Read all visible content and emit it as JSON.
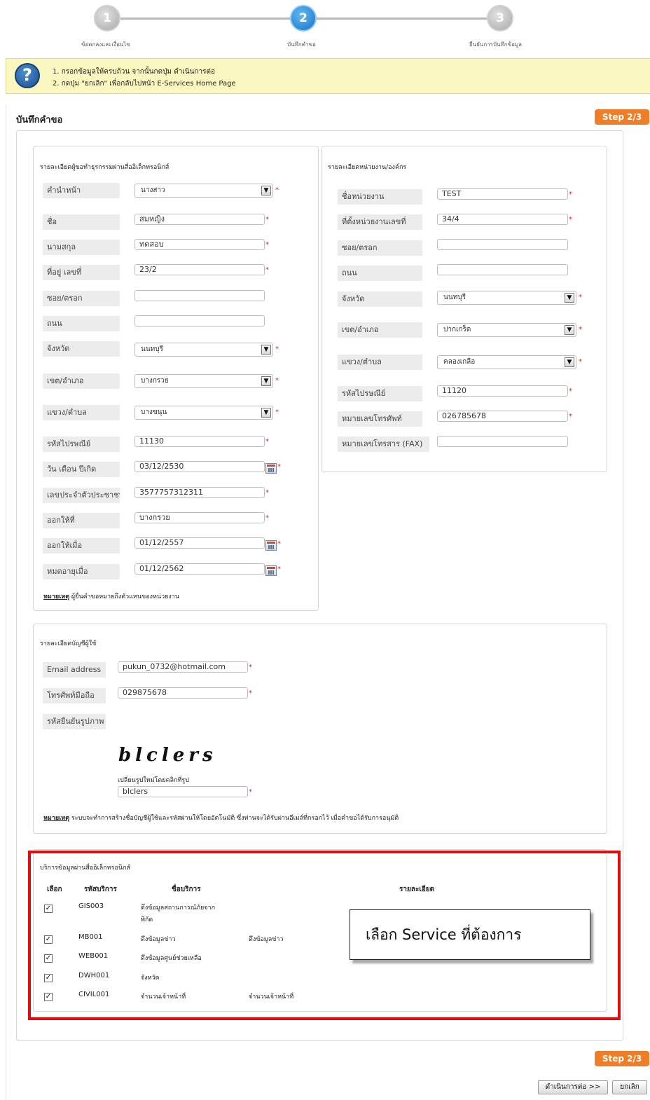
{
  "stepper": {
    "steps": [
      {
        "number": "1",
        "label": "ข้อตกลงและเงื่อนไข"
      },
      {
        "number": "2",
        "label": "บันทึกคำขอ"
      },
      {
        "number": "3",
        "label": "ยืนยันการบันทึกข้อมูล"
      }
    ]
  },
  "info": {
    "lines": [
      "1.  กรอกข้อมูลให้ครบถ้วน จากนั้นกดปุ่ม ดำเนินการต่อ",
      "2.  กดปุ่ม \"ยกเลิก\" เพื่อกลับไปหน้า E-Services Home Page"
    ]
  },
  "page": {
    "title": "บันทึกคำขอ",
    "step_badge": "Step 2/3"
  },
  "applicant": {
    "title": "รายละเอียดผู้ขอทำธุรกรรมผ่านสื่ออิเล็กทรอนิกส์",
    "labels": {
      "prefix": "คำนำหน้า",
      "first_name": "ชื่อ",
      "last_name": "นามสกุล",
      "address_no": "ที่อยู่ เลขที่",
      "soi": "ซอย/ตรอก",
      "road": "ถนน",
      "province": "จังหวัด",
      "district": "เขต/อำเภอ",
      "subdistrict": "แขวง/ตำบล",
      "postcode": "รหัสไปรษณีย์",
      "birthdate": "วัน เดือน ปีเกิด",
      "citizen_id": "เลขประจำตัวประชาชน",
      "issued_at": "ออกให้ที่",
      "issued_on": "ออกให้เมื่อ",
      "expires_on": "หมดอายุเมื่อ"
    },
    "values": {
      "prefix": "นางสาว",
      "first_name": "สมหญิง",
      "last_name": "ทดสอบ",
      "address_no": "23/2",
      "soi": "",
      "road": "",
      "province": "นนทบุรี",
      "district": "บางกรวย",
      "subdistrict": "บางขนุน",
      "postcode": "11130",
      "birthdate": "03/12/2530",
      "citizen_id": "3577757312311",
      "issued_at": "บางกรวย",
      "issued_on": "01/12/2557",
      "expires_on": "01/12/2562"
    },
    "note_label": "หมายเหตุ",
    "note_text": " ผู้ยื่นคำขอหมายถึงตัวแทนของหน่วยงาน"
  },
  "organization": {
    "title": "รายละเอียดหน่วยงาน/องค์กร",
    "labels": {
      "name": "ชื่อหน่วยงาน",
      "address_no": "ที่ตั้งหน่วยงานเลขที่",
      "soi": "ซอย/ตรอก",
      "road": "ถนน",
      "province": "จังหวัด",
      "district": "เขต/อำเภอ",
      "subdistrict": "แขวง/ตำบล",
      "postcode": "รหัสไปรษณีย์",
      "phone": "หมายเลขโทรศัพท์",
      "fax": "หมายเลขโทรสาร (FAX)"
    },
    "values": {
      "name": "TEST",
      "address_no": "34/4",
      "soi": "",
      "road": "",
      "province": "นนทบุรี",
      "district": "ปากเกร็ด",
      "subdistrict": "คลองเกลือ",
      "postcode": "11120",
      "phone": "026785678",
      "fax": ""
    }
  },
  "account": {
    "title": "รายละเอียดบัญชีผู้ใช้",
    "labels": {
      "email": "Email address",
      "mobile": "โทรศัพท์มือถือ",
      "captcha": "รหัสยืนยันรูปภาพ"
    },
    "values": {
      "email": "pukun_0732@hotmail.com",
      "mobile": "029875678",
      "captcha_input": "blclers"
    },
    "captcha_image_text": "blclers",
    "captcha_refresh": "เปลี่ยนรูปใหม่โดยคลิกที่รูป",
    "note_label": "หมายเหตุ",
    "note_text": " ระบบจะทำการสร้างชื่อบัญชีผู้ใช้และรหัสผ่านให้โดยอัตโนมัติ ซึ่งท่านจะได้รับผ่านอีเมล์ที่กรอกไว้ เมื่อคำขอได้รับการอนุมัติ"
  },
  "services": {
    "title": "บริการข้อมูลผ่านสื่ออิเล็กทรอนิกส์",
    "headers": {
      "select": "เลือก",
      "code": "รหัสบริการ",
      "name": "ชื่อบริการ",
      "detail": "รายละเอียด"
    },
    "rows": [
      {
        "checked": true,
        "code": "GIS003",
        "name_line1": "ดึงข้อมูลสถานการณ์ภัยจาก",
        "name_line2": "พิกัด",
        "detail": ""
      },
      {
        "checked": true,
        "code": "MB001",
        "name_line1": "ดึงข้อมูลข่าว",
        "name_line2": "",
        "detail": "ดึงข้อมูลข่าว"
      },
      {
        "checked": true,
        "code": "WEB001",
        "name_line1": "ดึงข้อมูลศูนย์ช่วยเหลือ",
        "name_line2": "",
        "detail": ""
      },
      {
        "checked": true,
        "code": "DWH001",
        "name_line1": "จังหวัด",
        "name_line2": "",
        "detail": ""
      },
      {
        "checked": true,
        "code": "CIVIL001",
        "name_line1": "จำนวนเจ้าหน้าที่",
        "name_line2": "",
        "detail": "จำนวนเจ้าหน้าที่"
      }
    ],
    "callout": "เลือก Service ที่ต้องการ"
  },
  "footer": {
    "step_badge": "Step 2/3",
    "continue_button": "ดำเนินการต่อ >>",
    "cancel_button": "ยกเลิก"
  },
  "colors": {
    "accent_orange": "#f07e26",
    "step_active": "#1e7fd4",
    "highlight_red": "#e10c0c",
    "info_bg": "#fbf7c1"
  }
}
